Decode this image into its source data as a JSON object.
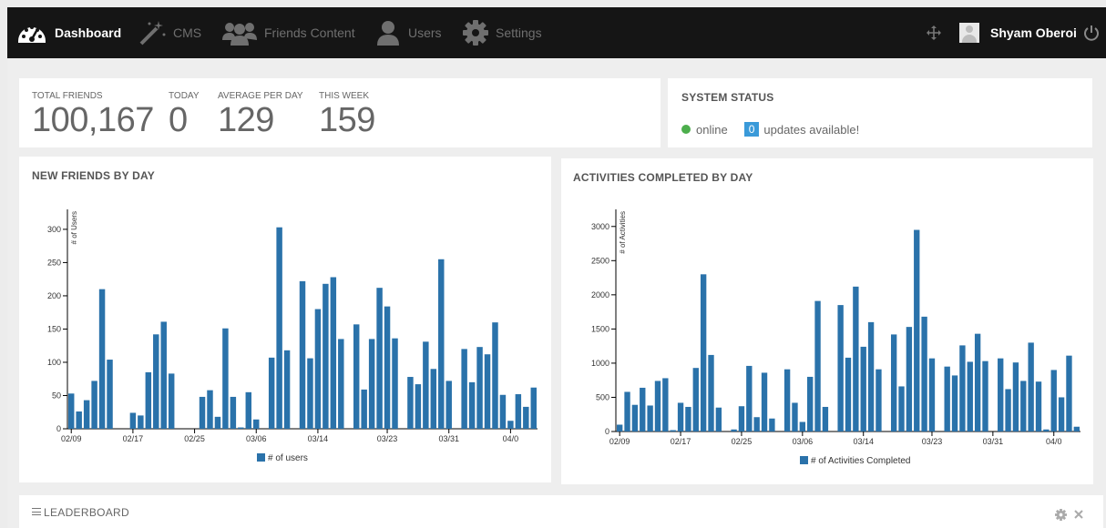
{
  "nav": {
    "items": [
      {
        "label": "Dashboard",
        "icon": "dashboard-gauge-icon",
        "active": true
      },
      {
        "label": "CMS",
        "icon": "magic-wand-icon",
        "active": false
      },
      {
        "label": "Friends Content",
        "icon": "group-users-icon",
        "active": false
      },
      {
        "label": "Users",
        "icon": "user-icon",
        "active": false
      },
      {
        "label": "Settings",
        "icon": "gear-icon",
        "active": false
      }
    ],
    "user_name": "Shyam Oberoi",
    "move_icon": "move-arrows-icon",
    "power_icon": "power-icon"
  },
  "stats": {
    "items": [
      {
        "label": "TOTAL FRIENDS",
        "value": "100,167"
      },
      {
        "label": "TODAY",
        "value": "0"
      },
      {
        "label": "AVERAGE PER DAY",
        "value": "129"
      },
      {
        "label": "THIS WEEK",
        "value": "159"
      }
    ]
  },
  "system_status": {
    "title": "SYSTEM STATUS",
    "status": "online",
    "status_color": "#4cae4c",
    "updates_count": "0",
    "updates_text": "updates available!"
  },
  "leaderboard": {
    "title": "LEADERBOARD",
    "settings_icon": "gear-icon",
    "close_icon": "close-icon"
  },
  "colors": {
    "bar": "#2a72aa",
    "nav_bg": "#151515",
    "badge": "#3a9ad9"
  },
  "chart_data": [
    {
      "type": "bar",
      "title": "NEW FRIENDS BY DAY",
      "ylabel": "# of Users",
      "legend": "# of users",
      "ylim": [
        0,
        330
      ],
      "yticks": [
        0,
        50,
        100,
        150,
        200,
        250,
        300
      ],
      "xticks": [
        {
          "label": "02/09",
          "index": 0
        },
        {
          "label": "02/17",
          "index": 8
        },
        {
          "label": "02/25",
          "index": 16
        },
        {
          "label": "03/06",
          "index": 24
        },
        {
          "label": "03/14",
          "index": 32
        },
        {
          "label": "03/23",
          "index": 41
        },
        {
          "label": "03/31",
          "index": 49
        },
        {
          "label": "04/0",
          "index": 57
        }
      ],
      "values": [
        53,
        26,
        43,
        72,
        210,
        104,
        0,
        0,
        24,
        20,
        85,
        142,
        161,
        83,
        0,
        0,
        0,
        48,
        58,
        18,
        151,
        48,
        2,
        55,
        14,
        0,
        107,
        303,
        118,
        0,
        222,
        106,
        180,
        218,
        228,
        135,
        0,
        157,
        59,
        135,
        212,
        184,
        136,
        0,
        78,
        67,
        131,
        90,
        255,
        72,
        0,
        120,
        70,
        123,
        112,
        160,
        51,
        12,
        52,
        33,
        62
      ]
    },
    {
      "type": "bar",
      "title": "ACTIVITIES COMPLETED BY DAY",
      "ylabel": "# of Activities",
      "legend": "# of Activities Completed",
      "ylim": [
        0,
        3250
      ],
      "yticks": [
        0,
        500,
        1000,
        1500,
        2000,
        2500,
        3000
      ],
      "xticks": [
        {
          "label": "02/09",
          "index": 0
        },
        {
          "label": "02/17",
          "index": 8
        },
        {
          "label": "02/25",
          "index": 16
        },
        {
          "label": "03/06",
          "index": 24
        },
        {
          "label": "03/14",
          "index": 32
        },
        {
          "label": "03/23",
          "index": 41
        },
        {
          "label": "03/31",
          "index": 49
        },
        {
          "label": "04/0",
          "index": 57
        }
      ],
      "values": [
        100,
        580,
        390,
        640,
        380,
        740,
        780,
        20,
        420,
        360,
        930,
        2300,
        1120,
        350,
        0,
        30,
        370,
        960,
        210,
        860,
        190,
        0,
        910,
        420,
        140,
        800,
        1910,
        360,
        0,
        1850,
        1080,
        2120,
        1240,
        1600,
        910,
        0,
        1420,
        660,
        1530,
        2950,
        1680,
        1070,
        0,
        950,
        820,
        1260,
        1020,
        1430,
        1030,
        0,
        1070,
        620,
        1010,
        740,
        1300,
        730,
        30,
        900,
        500,
        1110,
        70
      ]
    }
  ]
}
